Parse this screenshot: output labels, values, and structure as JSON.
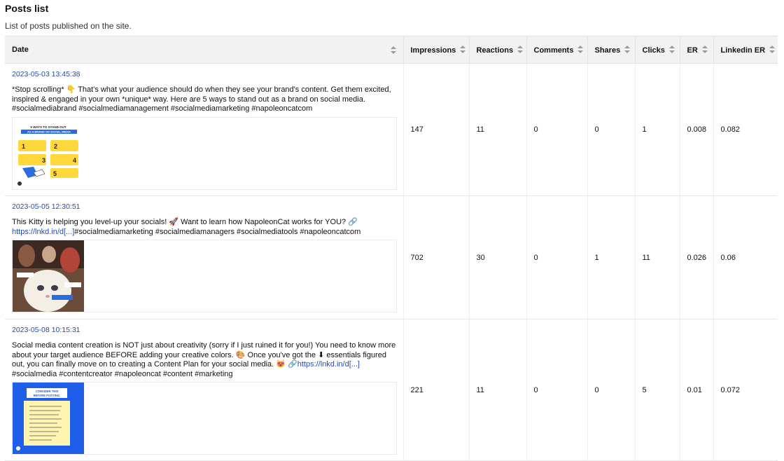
{
  "page": {
    "title": "Posts list",
    "subtitle": "List of posts published on the site."
  },
  "columns": [
    {
      "label": "Date"
    },
    {
      "label": "Impressions"
    },
    {
      "label": "Reactions"
    },
    {
      "label": "Comments"
    },
    {
      "label": "Shares"
    },
    {
      "label": "Clicks"
    },
    {
      "label": "ER"
    },
    {
      "label": "Linkedin ER"
    }
  ],
  "posts": [
    {
      "date": "2023-05-03 13:45:38",
      "text": "*Stop scrolling* 👇 That's what your audience should do when they see your brand's content. Get them excited, inspired & engaged in your own *unique* way. Here are 5 ways to stand out as a brand on social media. #socialmediabrand #socialmediamanagement #socialmediamarketing #napoleoncatcom",
      "link": "",
      "text_after": "",
      "thumbnail": "infographic-thumbnail",
      "thumb_title": "5 WAYS TO STAND OUT",
      "thumb_subtitle": "AS A BRAND ON SOCIAL MEDIA",
      "impressions": "147",
      "reactions": "11",
      "comments": "0",
      "shares": "0",
      "clicks": "1",
      "er": "0.008",
      "linkedin_er": "0.082"
    },
    {
      "date": "2023-05-05 12:30:51",
      "text": "This Kitty is helping you level-up your socials! 🚀 Want to learn how NapoleonCat works for YOU? 🔗 ",
      "link": "https://lnkd.in/d[...]",
      "text_after": "#socialmediamarketing #socialmediamanagers #socialmediatools #napoleoncatcom",
      "thumbnail": "cat-photo-thumbnail",
      "impressions": "702",
      "reactions": "30",
      "comments": "0",
      "shares": "1",
      "clicks": "11",
      "er": "0.026",
      "linkedin_er": "0.06"
    },
    {
      "date": "2023-05-08 10:15:31",
      "text": "Social media content creation is NOT just about creativity (sorry if I just ruined it for you!) You need to know more about your target audience BEFORE adding your creative colors. 🎨 Once you've got the ⬇ essentials figured out, you can finally move on to creating a Content Plan for your social media. 😻 🔗",
      "link": "https://lnkd.in/d[...]",
      "text_after": " #socialmedia #contentcreator #napoleoncat #content #marketing",
      "thumbnail": "checklist-thumbnail",
      "thumb_title": "CONSIDER THIS BEFORE POSTING:",
      "impressions": "221",
      "reactions": "11",
      "comments": "0",
      "shares": "0",
      "clicks": "5",
      "er": "0.01",
      "linkedin_er": "0.072"
    }
  ],
  "colors": {
    "header_bg": "#f2f2f2",
    "date_link": "#2a4aa0",
    "link": "#2448b8"
  }
}
